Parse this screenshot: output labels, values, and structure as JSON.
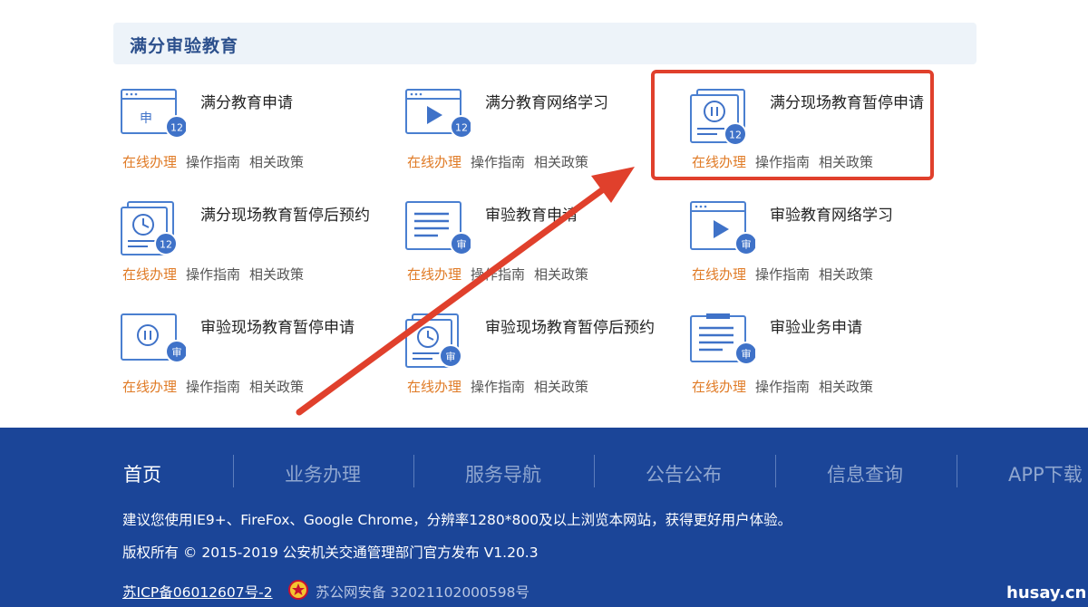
{
  "section": {
    "title": "满分审验教育"
  },
  "actions": {
    "online": "在线办理",
    "guide": "操作指南",
    "policy": "相关政策"
  },
  "cards": [
    {
      "title": "满分教育申请",
      "icon": "form-icon",
      "badge": "12",
      "glyph": "申"
    },
    {
      "title": "满分教育网络学习",
      "icon": "video-play-icon",
      "badge": "12"
    },
    {
      "title": "满分现场教育暂停申请",
      "icon": "pause-document-icon",
      "badge": "12"
    },
    {
      "title": "满分现场教育暂停后预约",
      "icon": "clock-document-icon",
      "badge": "12"
    },
    {
      "title": "审验教育申请",
      "icon": "document-lines-icon",
      "badge": "审"
    },
    {
      "title": "审验教育网络学习",
      "icon": "video-play-icon",
      "badge": "审"
    },
    {
      "title": "审验现场教育暂停申请",
      "icon": "pause-icon",
      "badge": "审"
    },
    {
      "title": "审验现场教育暂停后预约",
      "icon": "clock-document-icon",
      "badge": "审"
    },
    {
      "title": "审验业务申请",
      "icon": "clipboard-icon",
      "badge": "审"
    }
  ],
  "footer": {
    "nav": [
      "首页",
      "业务办理",
      "服务导航",
      "公告公布",
      "信息查询",
      "APP下载"
    ],
    "notice": "建议您使用IE9+、FireFox、Google Chrome，分辨率1280*800及以上浏览本网站，获得更好用户体验。",
    "copyright": "版权所有 © 2015-2019 公安机关交通管理部门官方发布 V1.20.3",
    "icp": "苏ICP备06012607号-2",
    "police_record": "苏公网安备 32021102000598号",
    "watermark": "husay.cn"
  },
  "colors": {
    "primary": "#1b4598",
    "accent_orange": "#e07b26",
    "icon_blue": "#3f72c8",
    "highlight_red": "#e0402c"
  }
}
